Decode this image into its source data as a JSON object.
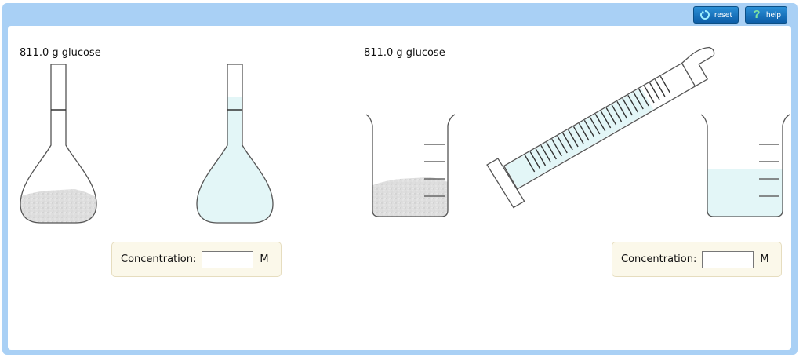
{
  "toolbar": {
    "reset_label": "reset",
    "help_label": "help",
    "reset_icon": "reset-arrow-icon",
    "help_icon": "question-mark-icon"
  },
  "problem1": {
    "sample_label": "811.0 g glucose",
    "concentration_label": "Concentration:",
    "concentration_value": "",
    "unit": "M"
  },
  "problem2": {
    "sample_label": "811.0 g glucose",
    "concentration_label": "Concentration:",
    "concentration_value": "",
    "unit": "M"
  },
  "colors": {
    "frame": "#a9d0f5",
    "liquid": "#e3f6f7",
    "solid": "#dcdcdc",
    "panel_bg": "#fbf8ea"
  }
}
